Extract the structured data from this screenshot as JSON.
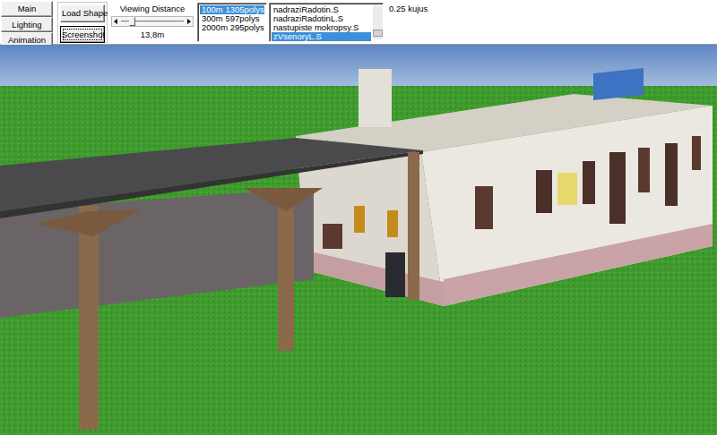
{
  "side_buttons": [
    {
      "label": "Main"
    },
    {
      "label": "Lighting"
    },
    {
      "label": "Animation"
    }
  ],
  "tool_buttons": [
    {
      "label": "Load Shape",
      "focused": false
    },
    {
      "label": "Screenshot",
      "focused": true
    }
  ],
  "viewing_distance": {
    "label": "Viewing Distance",
    "level": 0.15,
    "reading": "13,8m"
  },
  "lod_list": {
    "items": [
      {
        "label": "100m 1305polys",
        "selected": true
      },
      {
        "label": "300m 597polys",
        "selected": false
      },
      {
        "label": "2000m 295polys",
        "selected": false
      }
    ]
  },
  "shape_list": {
    "items": [
      {
        "label": "nadraziRadotin.S",
        "selected": false
      },
      {
        "label": "nadraziRadotinL.S",
        "selected": false
      },
      {
        "label": "nastupiste mokropsy.S",
        "selected": false
      },
      {
        "label": "zVsenoryL.S",
        "selected": true
      }
    ],
    "scroll_level": 0.85
  },
  "size_reading": "0.25 kujus"
}
